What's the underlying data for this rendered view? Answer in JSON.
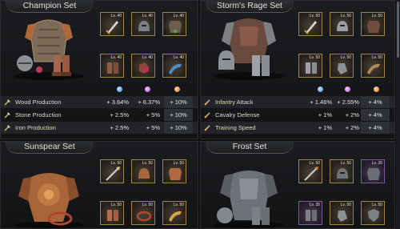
{
  "sets": [
    {
      "title": "Champion Set",
      "slots": [
        {
          "level": "Lv. 40",
          "icon": "sword-icon"
        },
        {
          "level": "Lv. 40",
          "icon": "helmet-icon"
        },
        {
          "level": "Lv. 40",
          "icon": "chest-armor-icon"
        },
        {
          "level": "Lv. 40",
          "icon": "boots-icon"
        },
        {
          "level": "Lv. 40",
          "icon": "gloves-icon"
        },
        {
          "level": "Lv. 40",
          "icon": "horn-icon"
        }
      ],
      "stats": [
        {
          "label": "Wood Production",
          "v1": "+ 3.64%",
          "v2": "+ 6.37%",
          "v3": "+ 10%"
        },
        {
          "label": "Stone Production",
          "v1": "+ 2.5%",
          "v2": "+ 5%",
          "v3": "+ 10%"
        },
        {
          "label": "Iron Production",
          "v1": "+ 2.5%",
          "v2": "+ 5%",
          "v3": "+ 10%"
        }
      ]
    },
    {
      "title": "Storm's Rage Set",
      "slots": [
        {
          "level": "Lv. 50",
          "icon": "sword-icon"
        },
        {
          "level": "Lv. 50",
          "icon": "helmet-icon"
        },
        {
          "level": "Lv. 50",
          "icon": "chest-armor-icon"
        },
        {
          "level": "Lv. 50",
          "icon": "greaves-icon"
        },
        {
          "level": "Lv. 50",
          "icon": "gauntlet-icon"
        },
        {
          "level": "Lv. 50",
          "icon": "horn-icon"
        }
      ],
      "stats": [
        {
          "label": "Infantry Attack",
          "v1": "+ 1.46%",
          "v2": "+ 2.55%",
          "v3": "+ 4%"
        },
        {
          "label": "Cavalry Defense",
          "v1": "+ 1%",
          "v2": "+ 2%",
          "v3": "+ 4%"
        },
        {
          "label": "Training Speed",
          "v1": "+ 1%",
          "v2": "+ 2%",
          "v3": "+ 4%"
        }
      ]
    },
    {
      "title": "Sunspear Set",
      "slots": [
        {
          "level": "Lv. 50",
          "icon": "spear-icon"
        },
        {
          "level": "Lv. 50",
          "icon": "helmet-icon"
        },
        {
          "level": "Lv. 50",
          "icon": "chest-armor-icon"
        },
        {
          "level": "Lv. 50",
          "icon": "boots-icon"
        },
        {
          "level": "Lv. 50",
          "icon": "belt-icon"
        },
        {
          "level": "Lv. 50",
          "icon": "horn-icon"
        }
      ]
    },
    {
      "title": "Frost Set",
      "slots": [
        {
          "level": "Lv. 50",
          "icon": "spear-icon"
        },
        {
          "level": "Lv. 50",
          "icon": "helmet-icon"
        },
        {
          "level": "Lv. 35",
          "icon": "chest-armor-icon",
          "rarity": "purple"
        },
        {
          "level": "Lv. 35",
          "icon": "boots-icon",
          "rarity": "purple"
        },
        {
          "level": "Lv. 50",
          "icon": "gauntlet-icon"
        },
        {
          "level": "Lv. 50",
          "icon": "shield-icon"
        }
      ]
    }
  ],
  "colors": {
    "gem_blue": "#3e8fd6",
    "gem_purple": "#b54ed4",
    "gem_orange": "#e0782a",
    "slot_gold": "#9d8545",
    "slot_purple": "#7d5a99"
  }
}
